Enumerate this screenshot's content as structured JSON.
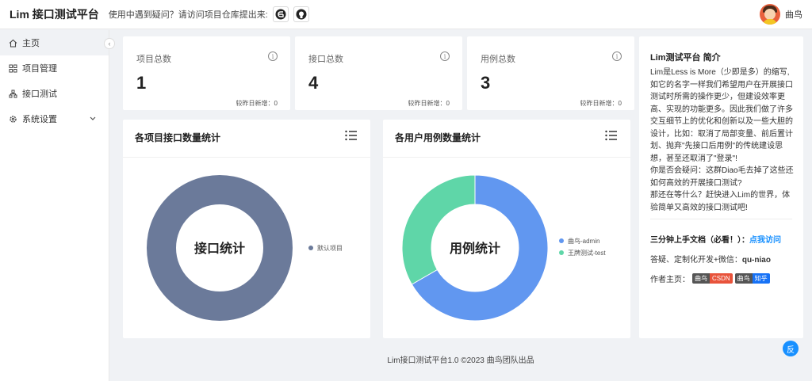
{
  "header": {
    "app_title": "Lim 接口测试平台",
    "help_text": "使用中遇到疑问？请访问项目仓库提出来:",
    "repo_buttons": [
      "gitee-icon",
      "github-icon"
    ],
    "user_name": "曲鸟"
  },
  "sidebar": {
    "items": [
      {
        "label": "主页",
        "icon": "home-icon"
      },
      {
        "label": "项目管理",
        "icon": "grid-icon"
      },
      {
        "label": "接口测试",
        "icon": "tree-icon"
      },
      {
        "label": "系统设置",
        "icon": "gear-icon"
      }
    ]
  },
  "stats": [
    {
      "label": "项目总数",
      "value": "1",
      "sub": "较昨日新增：0"
    },
    {
      "label": "接口总数",
      "value": "4",
      "sub": "较昨日新增：0"
    },
    {
      "label": "用例总数",
      "value": "3",
      "sub": "较昨日新增：0"
    }
  ],
  "chart_data": [
    {
      "type": "pie",
      "title": "各项目接口数量统计",
      "center_label": "接口统计",
      "series": [
        {
          "name": "默认项目",
          "value": 4,
          "color": "#6b7a9a"
        }
      ]
    },
    {
      "type": "pie",
      "title": "各用户用例数量统计",
      "center_label": "用例统计",
      "series": [
        {
          "name": "曲鸟-admin",
          "value": 2,
          "color": "#6197f0"
        },
        {
          "name": "王牌测试-test",
          "value": 1,
          "color": "#5fd6a8"
        }
      ]
    }
  ],
  "intro": {
    "title": "Lim测试平台 简介",
    "body": [
      "Lim是Less is More（少即是多）的缩写,",
      "如它的名字一样我们希望用户在开展接口",
      "测试时所需的操作更少，但建设效率更",
      "高、实现的功能更多。因此我们做了许多",
      "交互细节上的优化和创新以及一些大胆的",
      "设计，比如：取消了局部变量、前后置计",
      "划、抛弃\"先接口后用例\"的传统建设思",
      "想，甚至还取消了\"登录\"!",
      "你是否会疑问：这群Diao毛去掉了这些还",
      "如何高效的开展接口测试?",
      "那还在等什么？赶快进入Lim的世界，体",
      "验简单又高效的接口测试吧!"
    ],
    "doc_prefix": "三分钟上手文档（必看！）：",
    "doc_link": "点我访问",
    "contact_prefix": "答疑、定制化开发+微信：",
    "contact_value": "qu-niao",
    "author_prefix": "作者主页：",
    "badges": [
      {
        "left": "曲鸟",
        "right": "CSDN",
        "color": "#e8533b"
      },
      {
        "left": "曲鸟",
        "right": "知乎",
        "color": "#1772f6"
      }
    ]
  },
  "footer": {
    "text": "Lim接口测试平台1.0 ©2023 曲鸟团队出品"
  },
  "float_button": {
    "label": "反"
  }
}
